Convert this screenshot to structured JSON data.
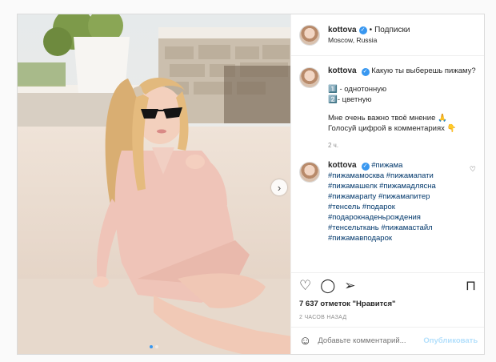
{
  "header": {
    "username": "kottova",
    "separator": "•",
    "follow_label": "Подписки",
    "location": "Moscow, Russia"
  },
  "caption": {
    "username": "kottova",
    "lines": [
      "Какую ты выберешь пижаму?",
      "1️⃣ - однотонную",
      "2️⃣- цветную",
      "Мне очень важно твоё мнение 🙏",
      "Голосуй цифрой в комментариях 👇"
    ],
    "time": "2 ч."
  },
  "comment": {
    "username": "kottova",
    "tags": [
      "#пижама",
      "#пижамамосква #пижамапати",
      "#пижамашелк #пижамадлясна",
      "#пижамаparty #пижамапитер",
      "#тенсель #подарок",
      "#подарокнаденьрождения",
      "#тенсельткань #пижамастайл",
      "#пижамавподарок"
    ]
  },
  "likes": "7 637 отметок \"Нравится\"",
  "time_ago": "2 ЧАСОВ НАЗАД",
  "add_comment": {
    "placeholder": "Добавьте комментарий...",
    "publish_label": "Опубликовать"
  },
  "icons": {
    "like": "heart-icon",
    "comment": "comment-icon",
    "share": "share-icon",
    "save": "bookmark-icon",
    "emoji": "smile-icon",
    "next": "chevron-right-icon"
  },
  "colors": {
    "verified": "#3897f0",
    "hashtag": "#00376b",
    "publish_disabled": "#b2dffc"
  },
  "carousel": {
    "slides": 2,
    "active": 1
  }
}
